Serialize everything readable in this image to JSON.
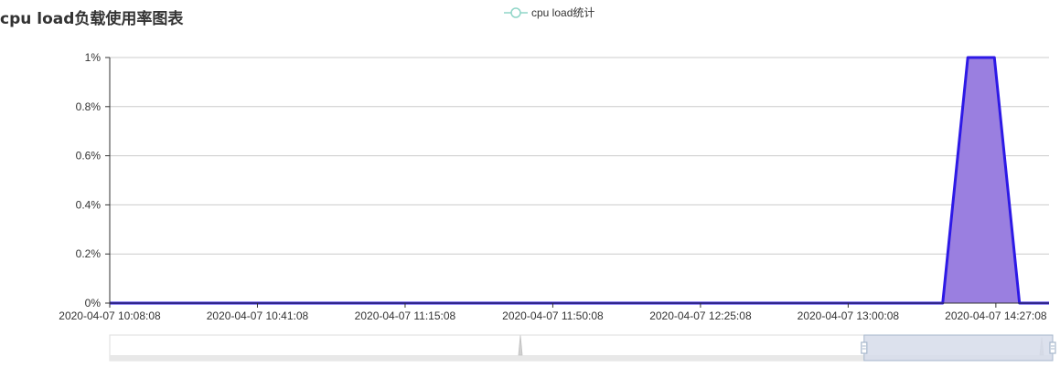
{
  "title": "cpu load负载使用率图表",
  "legend": {
    "label": "cpu load统计",
    "color": "#90d6c8"
  },
  "colors": {
    "line": "#2d19e6",
    "area": "#9a7fe0",
    "grid": "#cccccc",
    "zoom_handle": "#a7b7cc",
    "zoom_fill": "#d6dcea"
  },
  "chart_data": {
    "type": "area",
    "title": "cpu load负载使用率图表",
    "xlabel": "",
    "ylabel": "",
    "y_tick_labels": [
      "0%",
      "0.2%",
      "0.4%",
      "0.6%",
      "0.8%",
      "1%"
    ],
    "y_ticks": [
      0,
      0.2,
      0.4,
      0.6,
      0.8,
      1
    ],
    "ylim": [
      0,
      1
    ],
    "x_tick_labels": [
      "2020-04-07 10:08:08",
      "2020-04-07 10:41:08",
      "2020-04-07 11:15:08",
      "2020-04-07 11:50:08",
      "2020-04-07 12:25:08",
      "2020-04-07 13:00:08",
      "2020-04-07 14:27:08"
    ],
    "x_tick_index": [
      0,
      5,
      10,
      15,
      20,
      25,
      30
    ],
    "series": [
      {
        "name": "cpu load统计",
        "x": [
          0,
          28.2,
          29.05,
          29.5,
          29.95,
          30.8,
          31.8
        ],
        "values": [
          0,
          0,
          1,
          1,
          1,
          0,
          0
        ]
      }
    ],
    "grid": true,
    "legend_position": "top-center",
    "data_zoom": {
      "start_percent": 80,
      "end_percent": 100
    }
  }
}
